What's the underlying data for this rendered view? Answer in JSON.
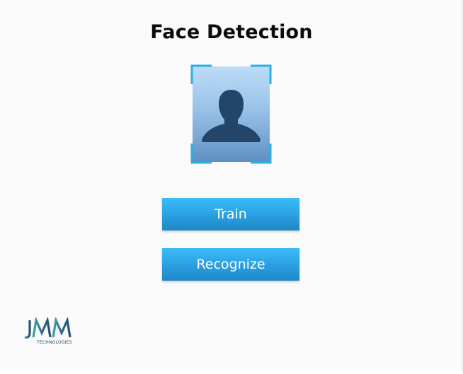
{
  "page": {
    "title": "Face Detection"
  },
  "face_preview": {
    "icon": "user-silhouette-icon",
    "frame_icon": "scan-frame-icon",
    "accent_color": "#2bb0e2"
  },
  "actions": {
    "train_label": "Train",
    "recognize_label": "Recognize"
  },
  "branding": {
    "logo_text": "JMM",
    "logo_subtext": "TECHNOLOGIES"
  }
}
